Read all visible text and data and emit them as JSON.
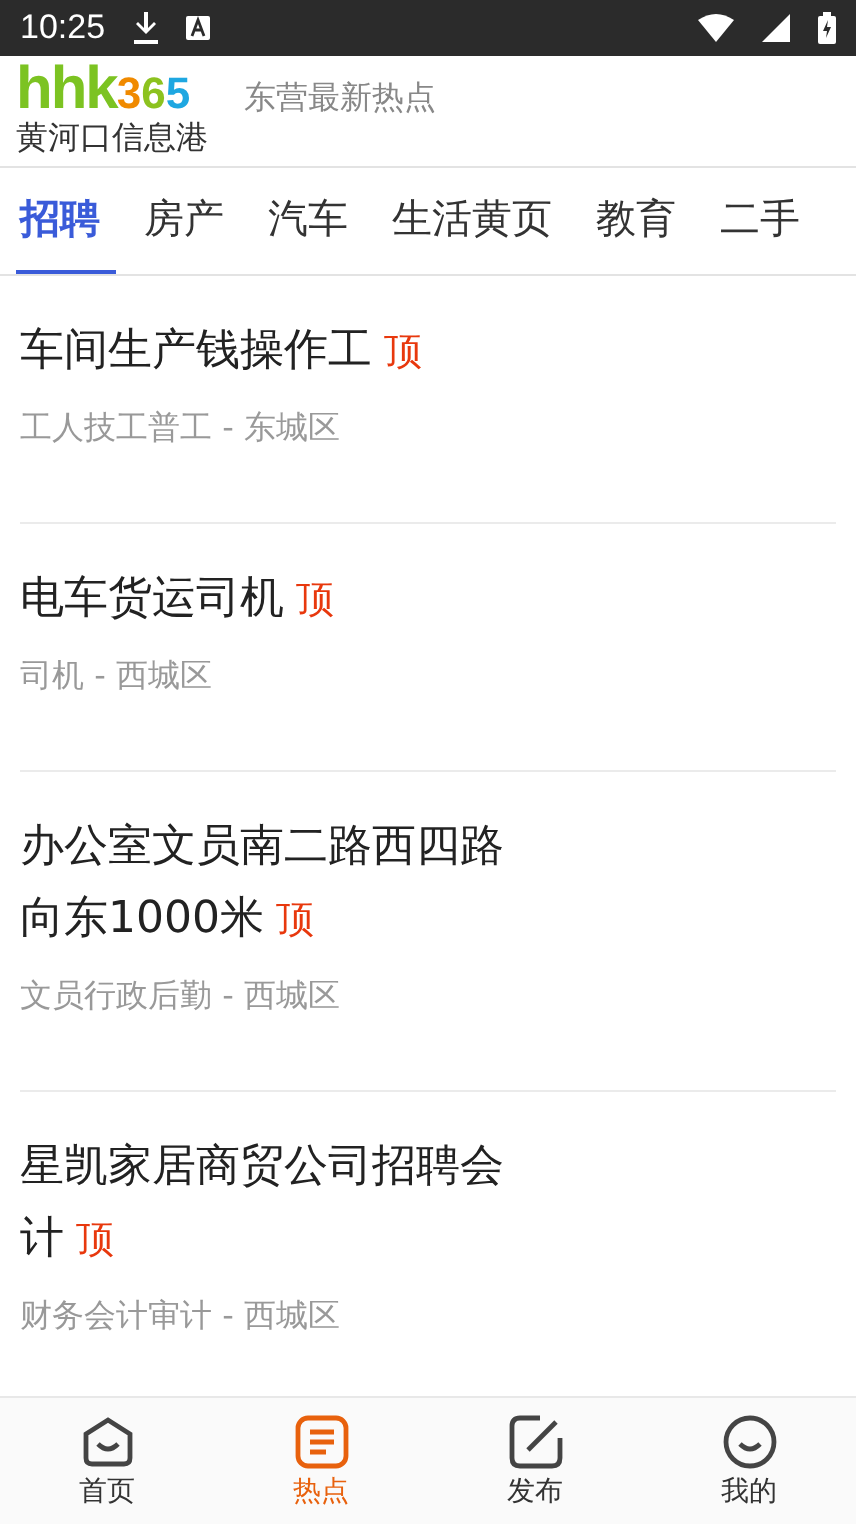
{
  "status_bar": {
    "time": "10:25"
  },
  "header": {
    "logo": {
      "letters": "hhk",
      "digits": "365",
      "name": "黄河口信息港"
    },
    "subtitle": "东营最新热点"
  },
  "tabs": [
    {
      "label": "招聘",
      "selected": true
    },
    {
      "label": "房产",
      "selected": false
    },
    {
      "label": "汽车",
      "selected": false
    },
    {
      "label": "生活黄页",
      "selected": false
    },
    {
      "label": "教育",
      "selected": false
    },
    {
      "label": "二手",
      "selected": false
    }
  ],
  "listings": [
    {
      "title": "车间生产钱操作工",
      "badge": "顶",
      "meta": "工人技工普工 - 东城区"
    },
    {
      "title": "电车货运司机",
      "badge": "顶",
      "meta": "司机 - 西城区"
    },
    {
      "title": "办公室文员南二路西四路向东1000米",
      "badge": "顶",
      "meta": "文员行政后勤 - 西城区"
    },
    {
      "title": "星凯家居商贸公司招聘会计",
      "badge": "顶",
      "meta": "财务会计审计 - 西城区"
    }
  ],
  "bottom_nav": [
    {
      "kind": "home",
      "label": "首页",
      "selected": false
    },
    {
      "kind": "hot",
      "label": "热点",
      "selected": true
    },
    {
      "kind": "post",
      "label": "发布",
      "selected": false
    },
    {
      "kind": "me",
      "label": "我的",
      "selected": false
    }
  ]
}
